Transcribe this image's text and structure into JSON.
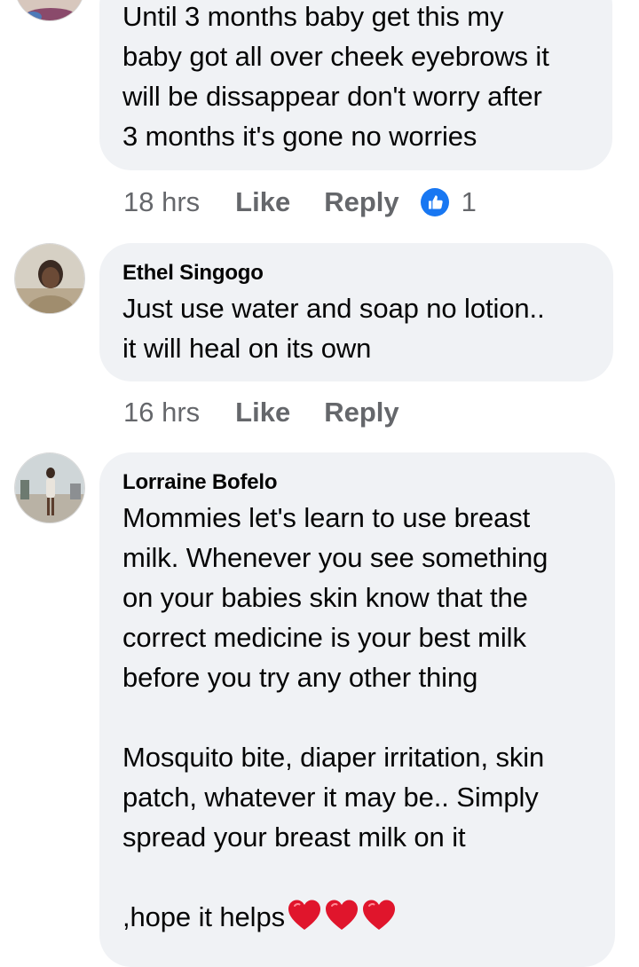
{
  "comments": [
    {
      "author": "",
      "text": "Until 3 months baby get this my\nbaby got all over cheek eyebrows it\nwill be dissappear don't worry after\n3 months it's gone no worries",
      "time": "18 hrs",
      "like_label": "Like",
      "reply_label": "Reply",
      "reaction_icon": "like-reaction-icon",
      "reaction_count": "1"
    },
    {
      "author": "Ethel Singogo",
      "text": "Just use water and soap no lotion..\nit will heal on its own",
      "time": "16 hrs",
      "like_label": "Like",
      "reply_label": "Reply"
    },
    {
      "author": "Lorraine Bofelo",
      "text_paragraph_1": "Mommies let's learn to use breast\nmilk. Whenever you see something\non your babies skin know that the\ncorrect medicine is your best milk\nbefore you try any other thing",
      "text_paragraph_2": "Mosquito bite, diaper irritation, skin\npatch, whatever it may be.. Simply\nspread your breast milk on it",
      "text_paragraph_3": ",hope it helps",
      "trailing_icons": [
        "red-heart-icon",
        "red-heart-icon",
        "red-heart-icon"
      ]
    }
  ],
  "colors": {
    "bubble_bg": "#f0f2f5",
    "meta_text": "#65676b",
    "like_blue": "#1877f2",
    "heart_red": "#e0152c"
  }
}
